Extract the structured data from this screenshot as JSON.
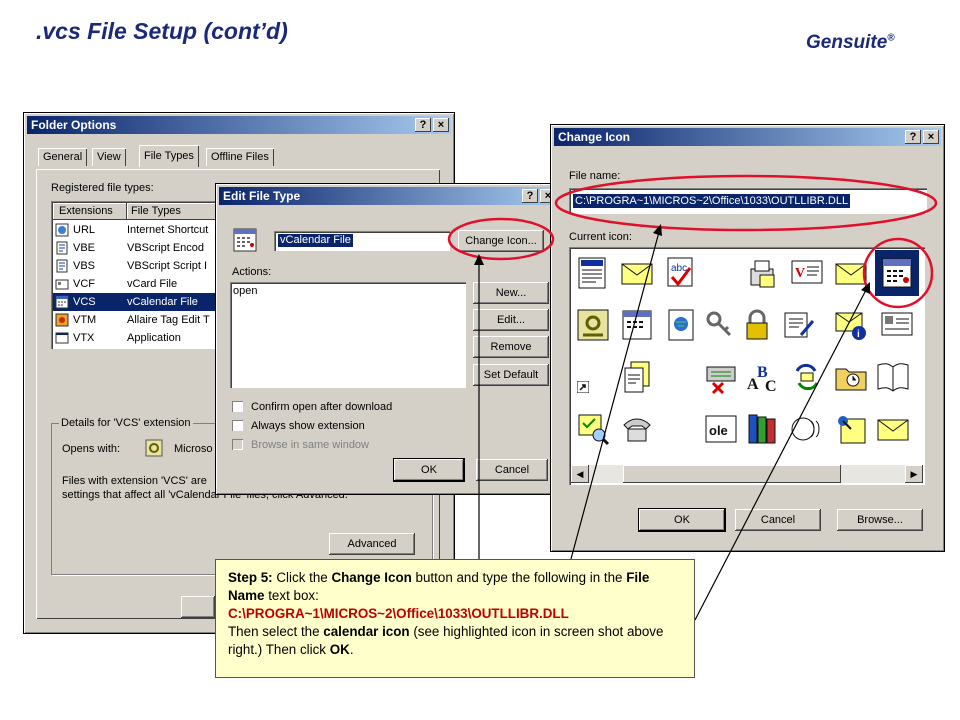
{
  "slide": {
    "title": ".vcs File Setup (cont’d)",
    "brand": "Gensuite",
    "brand_mark": "®"
  },
  "folder_options": {
    "title": "Folder Options",
    "help_btn": "?",
    "close_btn": "×",
    "tabs": [
      "General",
      "View",
      "File Types",
      "Offline Files"
    ],
    "registered_label": "Registered file types:",
    "columns": [
      "Extensions",
      "File Types"
    ],
    "rows": [
      {
        "ext": "URL",
        "type": "Internet Shortcut"
      },
      {
        "ext": "VBE",
        "type": "VBScript Encod"
      },
      {
        "ext": "VBS",
        "type": "VBScript Script I"
      },
      {
        "ext": "VCF",
        "type": "vCard File"
      },
      {
        "ext": "VCS",
        "type": "vCalendar File"
      },
      {
        "ext": "VTM",
        "type": "Allaire Tag Edit T"
      },
      {
        "ext": "VTX",
        "type": "Application"
      }
    ],
    "details_label": "Details for 'VCS' extension",
    "opens_with": "Opens with:",
    "opens_app": "Microso",
    "info_line1": "Files with extension 'VCS' are",
    "info_line2": "settings that affect all 'vCalendar File' files, click Advanced.",
    "advanced_btn": "Advanced"
  },
  "edit_file_type": {
    "title": "Edit File Type",
    "help_btn": "?",
    "close_btn": "×",
    "name_value": "vCalendar File",
    "change_icon_btn": "Change Icon...",
    "actions_label": "Actions:",
    "actions": [
      "open"
    ],
    "new_btn": "New...",
    "edit_btn": "Edit...",
    "remove_btn": "Remove",
    "default_btn": "Set Default",
    "confirm_open": "Confirm open after download",
    "always_show": "Always show extension",
    "browse_same": "Browse in same window",
    "ok_btn": "OK",
    "cancel_btn": "Cancel"
  },
  "change_icon": {
    "title": "Change Icon",
    "help_btn": "?",
    "close_btn": "×",
    "file_name_label": "File name:",
    "file_name_value": "C:\\PROGRA~1\\MICROS~2\\Office\\1033\\OUTLLIBR.DLL",
    "current_icon_label": "Current icon:",
    "ok_btn": "OK",
    "cancel_btn": "Cancel",
    "browse_btn": "Browse..."
  },
  "callout": {
    "step": "Step 5:",
    "t1": " Click the ",
    "b1": "Change Icon",
    "t2": " button and type the following in the ",
    "b2": "File Name",
    "t3": " text box:",
    "path": "C:\\PROGRA~1\\MICROS~2\\Office\\1033\\OUTLLIBR.DLL",
    "t4": "Then select the ",
    "b3": "calendar icon",
    "t5": " (see highlighted icon in screen shot above right.) Then click ",
    "b4": "OK",
    "t6": "."
  },
  "colors": {
    "title": "#1a2a78",
    "highlight": "#e0102a",
    "selection": "#0a246a",
    "callout_bg": "#ffffcc"
  }
}
